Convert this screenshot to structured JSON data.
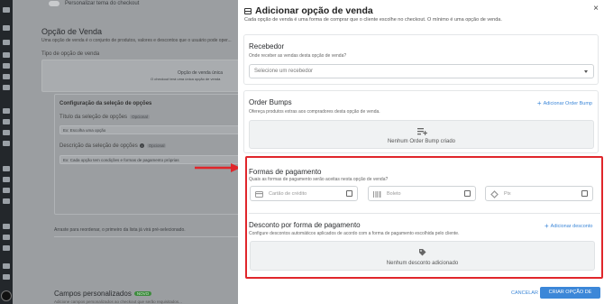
{
  "background": {
    "toggle_label": "Personalizar tema do checkout",
    "section_title": "Opção de Venda",
    "section_desc": "Uma opção de venda é o conjunto de produtos, valores e descontos que o usuário pode oper...",
    "type_label": "Tipo de opção de venda",
    "card_title": "Opção de venda única",
    "card_desc": "O checkout terá uma única opção de venda",
    "config_title": "Configuração da seleção de opções",
    "selection_title_label": "Título da seleção de opções",
    "optional_tag": "Opcional",
    "selection_title_value": "Ex: Escolha uma opção",
    "selection_desc_label": "Descrição da seleção de opções",
    "selection_desc_value": "Ex: Cada opção tem condições e formas de pagamento próprias",
    "drag_note": "Arraste para reordenar, o primeiro da lista já virá pré-selecionado.",
    "custom_fields_title": "Campos personalizados",
    "new_badge": "NOVO",
    "custom_fields_desc": "Adicione campos personalizados ao checkout que serão requisitados..."
  },
  "drawer": {
    "title": "Adicionar opção de venda",
    "subtitle": "Cada opção de venda é uma forma de comprar que o cliente escolhe no checkout. O mínimo é uma opção de venda.",
    "close": "×",
    "receiver": {
      "title": "Recebedor",
      "desc": "Onde receber as vendas desta opção de venda?",
      "placeholder": "Selecione um recebedor"
    },
    "order_bumps": {
      "title": "Order Bumps",
      "desc": "Ofereça produtos extras aos compradores desta opção de venda.",
      "add_label": "Adicionar Order Bump",
      "empty_text": "Nenhum Order Bump criado"
    },
    "payment_methods": {
      "title": "Formas de pagamento",
      "desc": "Quais as formas de pagamento serão aceitas nesta opção de venda?",
      "options": [
        {
          "label": "Cartão de crédito",
          "icon": "credit-card-icon",
          "checked": false
        },
        {
          "label": "Boleto",
          "icon": "barcode-icon",
          "checked": false
        },
        {
          "label": "Pix",
          "icon": "pix-icon",
          "checked": false
        }
      ]
    },
    "discount": {
      "title": "Desconto por forma de pagamento",
      "desc": "Configure descontos automáticos aplicados de acordo com a forma de pagamento escolhida pelo cliente.",
      "add_label": "Adicionar desconto",
      "empty_text": "Nenhum desconto adicionado"
    },
    "footer": {
      "cancel": "CANCELAR",
      "create": "CRIAR OPÇÃO DE VENDA"
    }
  },
  "colors": {
    "accent": "#3c87d8",
    "highlight": "#e0262b",
    "new_badge": "#3d8b3d"
  }
}
